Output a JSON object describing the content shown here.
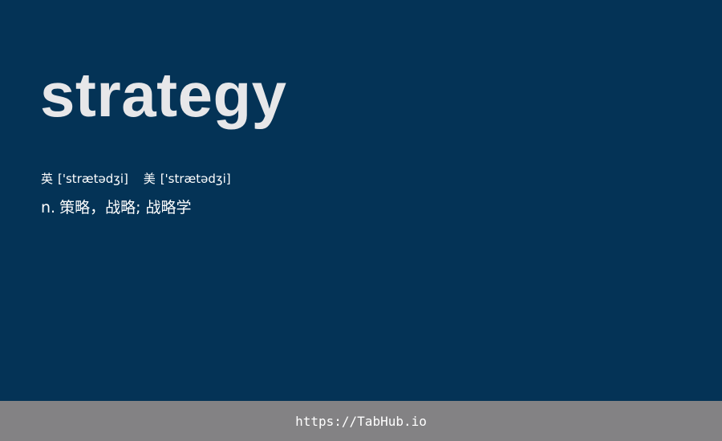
{
  "word": {
    "headword": "strategy",
    "phonetics": {
      "uk_label": "英",
      "uk_ipa": "['strætədʒi]",
      "us_label": "美",
      "us_ipa": "['strætədʒi]"
    },
    "definition": {
      "part_of_speech": "n.",
      "meaning": "策略，战略; 战略学"
    }
  },
  "footer": {
    "link_text": "https://TabHub.io"
  },
  "colors": {
    "background": "#043356",
    "headword": "#e7e7e9",
    "footer_bar": "#838284",
    "text": "#ffffff"
  }
}
